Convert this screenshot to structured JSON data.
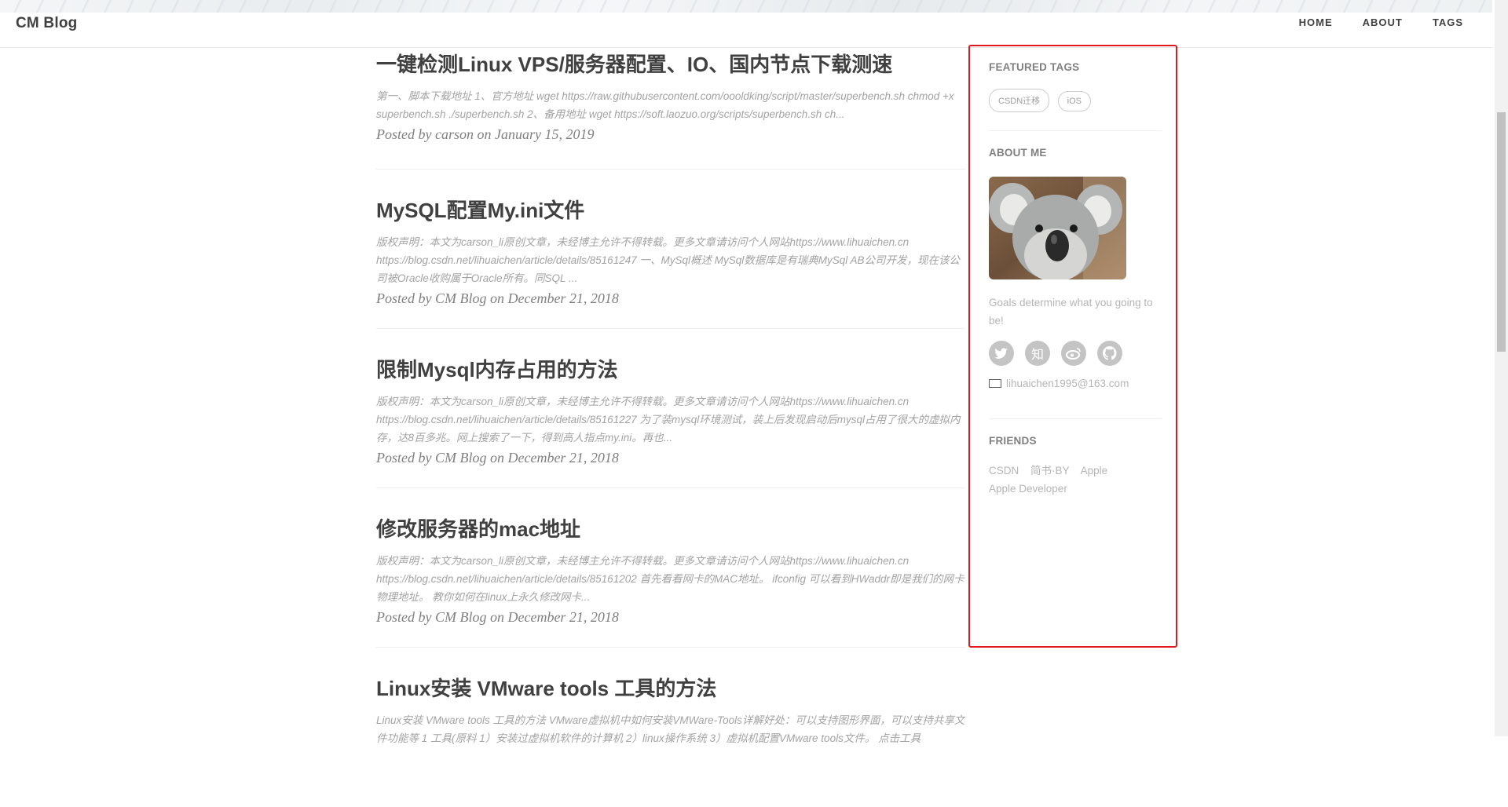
{
  "header": {
    "brand": "CM Blog",
    "nav": [
      "HOME",
      "ABOUT",
      "TAGS"
    ]
  },
  "posts": [
    {
      "title": "一键检测Linux VPS/服务器配置、IO、国内节点下载测速",
      "excerpt": "第一、脚本下载地址 1、官方地址 wget https://raw.githubusercontent.com/oooldking/script/master/superbench.sh chmod +x superbench.sh ./superbench.sh 2、备用地址 wget https://soft.laozuo.org/scripts/superbench.sh ch...",
      "meta": "Posted by carson on January 15, 2019"
    },
    {
      "title": "MySQL配置My.ini文件",
      "excerpt": "版权声明：本文为carson_li原创文章，未经博主允许不得转载。更多文章请访问个人网站https://www.lihuaichen.cn https://blog.csdn.net/lihuaichen/article/details/85161247 一、MySql概述 MySql数据库是有瑞典MySql AB公司开发，现在该公司被Oracle收购属于Oracle所有。同SQL ...",
      "meta": "Posted by CM Blog on December 21, 2018"
    },
    {
      "title": "限制Mysql内存占用的方法",
      "excerpt": "版权声明：本文为carson_li原创文章，未经博主允许不得转载。更多文章请访问个人网站https://www.lihuaichen.cn https://blog.csdn.net/lihuaichen/article/details/85161227 为了装mysql环境测试，装上后发现启动后mysql占用了很大的虚拟内存，达8百多兆。网上搜索了一下，得到高人指点my.ini。再也...",
      "meta": "Posted by CM Blog on December 21, 2018"
    },
    {
      "title": "修改服务器的mac地址",
      "excerpt": "版权声明：本文为carson_li原创文章，未经博主允许不得转载。更多文章请访问个人网站https://www.lihuaichen.cn https://blog.csdn.net/lihuaichen/article/details/85161202 首先看看网卡的MAC地址。 ifconfig 可以看到HWaddr即是我们的网卡物理地址。 教你如何在linux上永久修改网卡...",
      "meta": "Posted by CM Blog on December 21, 2018"
    },
    {
      "title": "Linux安装 VMware tools 工具的方法",
      "excerpt": "Linux安装 VMware tools 工具的方法 VMware虚拟机中如何安装VMWare-Tools详解好处：可以支持图形界面，可以支持共享文件功能等 1 工具(原料 1）安装过虚拟机软件的计算机 2）linux操作系统 3）虚拟机配置VMware tools文件。 点击工具",
      "meta": ""
    }
  ],
  "sidebar": {
    "featured_tags_heading": "FEATURED TAGS",
    "tags": [
      "CSDN迁移",
      "iOS"
    ],
    "about_heading": "ABOUT ME",
    "motto": "Goals determine what you going to be!",
    "social": [
      {
        "name": "twitter-icon",
        "glyph": "🐦"
      },
      {
        "name": "zhihu-icon",
        "glyph": "知"
      },
      {
        "name": "weibo-icon",
        "glyph": "◎"
      },
      {
        "name": "github-icon",
        "glyph": "●"
      }
    ],
    "email": "lihuaichen1995@163.com",
    "friends_heading": "FRIENDS",
    "friends": [
      "CSDN",
      "简书·BY",
      "Apple",
      "Apple Developer"
    ]
  },
  "colors": {
    "highlight_border": "#e0191f",
    "text": "#404040",
    "muted": "#a3a3a3"
  }
}
